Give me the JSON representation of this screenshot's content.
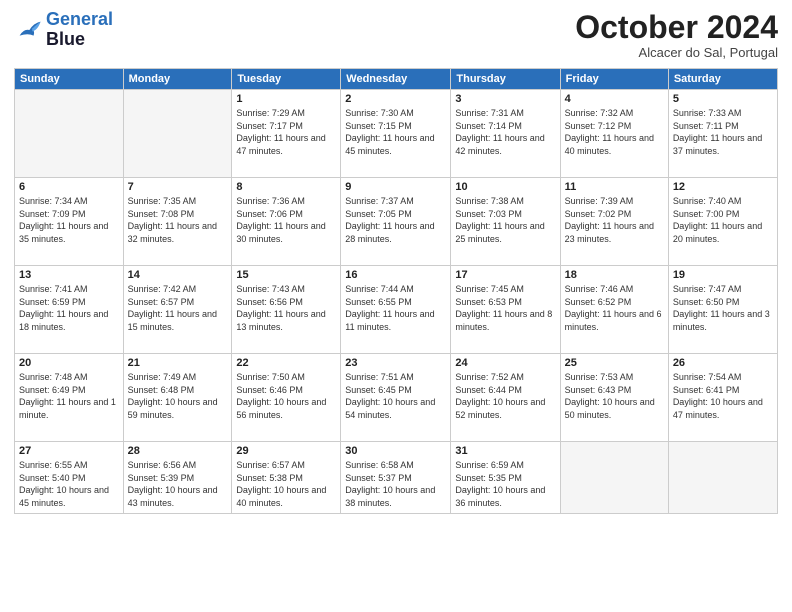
{
  "header": {
    "logo": {
      "line1": "General",
      "line2": "Blue"
    },
    "title": "October 2024",
    "subtitle": "Alcacer do Sal, Portugal"
  },
  "weekdays": [
    "Sunday",
    "Monday",
    "Tuesday",
    "Wednesday",
    "Thursday",
    "Friday",
    "Saturday"
  ],
  "weeks": [
    [
      {
        "day": "",
        "info": ""
      },
      {
        "day": "",
        "info": ""
      },
      {
        "day": "1",
        "info": "Sunrise: 7:29 AM\nSunset: 7:17 PM\nDaylight: 11 hours and 47 minutes."
      },
      {
        "day": "2",
        "info": "Sunrise: 7:30 AM\nSunset: 7:15 PM\nDaylight: 11 hours and 45 minutes."
      },
      {
        "day": "3",
        "info": "Sunrise: 7:31 AM\nSunset: 7:14 PM\nDaylight: 11 hours and 42 minutes."
      },
      {
        "day": "4",
        "info": "Sunrise: 7:32 AM\nSunset: 7:12 PM\nDaylight: 11 hours and 40 minutes."
      },
      {
        "day": "5",
        "info": "Sunrise: 7:33 AM\nSunset: 7:11 PM\nDaylight: 11 hours and 37 minutes."
      }
    ],
    [
      {
        "day": "6",
        "info": "Sunrise: 7:34 AM\nSunset: 7:09 PM\nDaylight: 11 hours and 35 minutes."
      },
      {
        "day": "7",
        "info": "Sunrise: 7:35 AM\nSunset: 7:08 PM\nDaylight: 11 hours and 32 minutes."
      },
      {
        "day": "8",
        "info": "Sunrise: 7:36 AM\nSunset: 7:06 PM\nDaylight: 11 hours and 30 minutes."
      },
      {
        "day": "9",
        "info": "Sunrise: 7:37 AM\nSunset: 7:05 PM\nDaylight: 11 hours and 28 minutes."
      },
      {
        "day": "10",
        "info": "Sunrise: 7:38 AM\nSunset: 7:03 PM\nDaylight: 11 hours and 25 minutes."
      },
      {
        "day": "11",
        "info": "Sunrise: 7:39 AM\nSunset: 7:02 PM\nDaylight: 11 hours and 23 minutes."
      },
      {
        "day": "12",
        "info": "Sunrise: 7:40 AM\nSunset: 7:00 PM\nDaylight: 11 hours and 20 minutes."
      }
    ],
    [
      {
        "day": "13",
        "info": "Sunrise: 7:41 AM\nSunset: 6:59 PM\nDaylight: 11 hours and 18 minutes."
      },
      {
        "day": "14",
        "info": "Sunrise: 7:42 AM\nSunset: 6:57 PM\nDaylight: 11 hours and 15 minutes."
      },
      {
        "day": "15",
        "info": "Sunrise: 7:43 AM\nSunset: 6:56 PM\nDaylight: 11 hours and 13 minutes."
      },
      {
        "day": "16",
        "info": "Sunrise: 7:44 AM\nSunset: 6:55 PM\nDaylight: 11 hours and 11 minutes."
      },
      {
        "day": "17",
        "info": "Sunrise: 7:45 AM\nSunset: 6:53 PM\nDaylight: 11 hours and 8 minutes."
      },
      {
        "day": "18",
        "info": "Sunrise: 7:46 AM\nSunset: 6:52 PM\nDaylight: 11 hours and 6 minutes."
      },
      {
        "day": "19",
        "info": "Sunrise: 7:47 AM\nSunset: 6:50 PM\nDaylight: 11 hours and 3 minutes."
      }
    ],
    [
      {
        "day": "20",
        "info": "Sunrise: 7:48 AM\nSunset: 6:49 PM\nDaylight: 11 hours and 1 minute."
      },
      {
        "day": "21",
        "info": "Sunrise: 7:49 AM\nSunset: 6:48 PM\nDaylight: 10 hours and 59 minutes."
      },
      {
        "day": "22",
        "info": "Sunrise: 7:50 AM\nSunset: 6:46 PM\nDaylight: 10 hours and 56 minutes."
      },
      {
        "day": "23",
        "info": "Sunrise: 7:51 AM\nSunset: 6:45 PM\nDaylight: 10 hours and 54 minutes."
      },
      {
        "day": "24",
        "info": "Sunrise: 7:52 AM\nSunset: 6:44 PM\nDaylight: 10 hours and 52 minutes."
      },
      {
        "day": "25",
        "info": "Sunrise: 7:53 AM\nSunset: 6:43 PM\nDaylight: 10 hours and 50 minutes."
      },
      {
        "day": "26",
        "info": "Sunrise: 7:54 AM\nSunset: 6:41 PM\nDaylight: 10 hours and 47 minutes."
      }
    ],
    [
      {
        "day": "27",
        "info": "Sunrise: 6:55 AM\nSunset: 5:40 PM\nDaylight: 10 hours and 45 minutes."
      },
      {
        "day": "28",
        "info": "Sunrise: 6:56 AM\nSunset: 5:39 PM\nDaylight: 10 hours and 43 minutes."
      },
      {
        "day": "29",
        "info": "Sunrise: 6:57 AM\nSunset: 5:38 PM\nDaylight: 10 hours and 40 minutes."
      },
      {
        "day": "30",
        "info": "Sunrise: 6:58 AM\nSunset: 5:37 PM\nDaylight: 10 hours and 38 minutes."
      },
      {
        "day": "31",
        "info": "Sunrise: 6:59 AM\nSunset: 5:35 PM\nDaylight: 10 hours and 36 minutes."
      },
      {
        "day": "",
        "info": ""
      },
      {
        "day": "",
        "info": ""
      }
    ]
  ]
}
